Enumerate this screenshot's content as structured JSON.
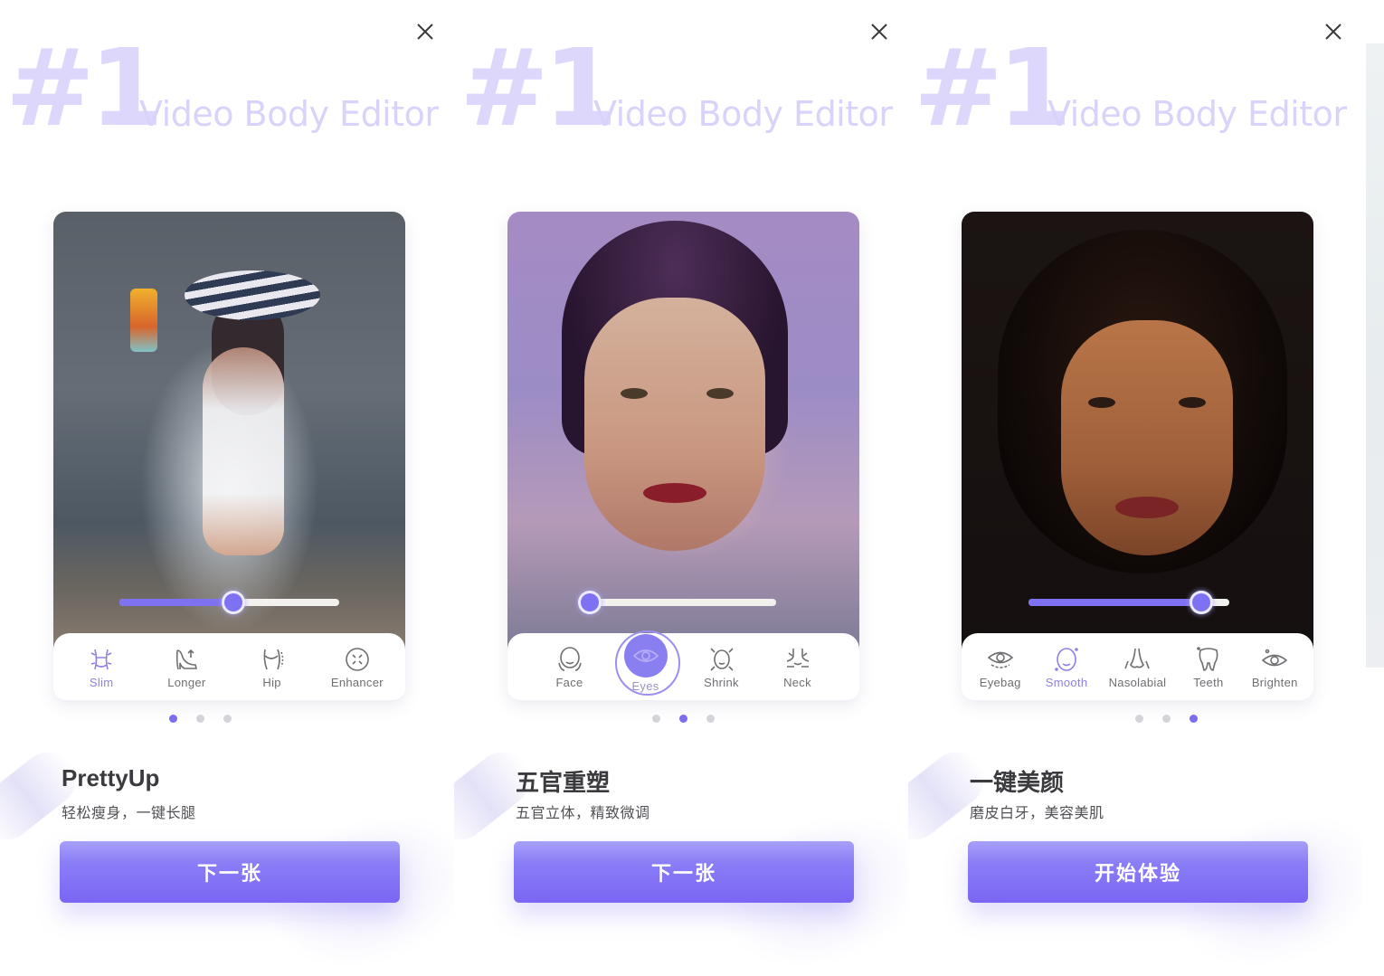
{
  "colors": {
    "accent": "#7b6cf0",
    "hero_text": "#dcd7fb",
    "button_top": "#a7a0f8",
    "button_bottom": "#7a66f4",
    "inactive_dot": "#d4d4d8"
  },
  "panels": [
    {
      "close_icon": "close-icon",
      "hero": {
        "rank": "#1",
        "tagline": "Video Body Editor"
      },
      "photo_description": "woman in striped sun hat and white swimsuit holding a drink on a beach",
      "slider": {
        "value_percent": 52
      },
      "tools": [
        {
          "label": "Slim",
          "icon": "waist-slim-icon",
          "active": true
        },
        {
          "label": "Longer",
          "icon": "high-heel-icon",
          "active": false
        },
        {
          "label": "Hip",
          "icon": "hip-icon",
          "active": false
        },
        {
          "label": "Enhancer",
          "icon": "expand-circle-icon",
          "active": false
        }
      ],
      "pagination": {
        "total": 3,
        "current": 1
      },
      "title": "PrettyUp",
      "subtitle": "轻松瘦身，一键长腿",
      "button_label": "下一张"
    },
    {
      "close_icon": "close-icon",
      "hero": {
        "rank": "#1",
        "tagline": "Video Body Editor"
      },
      "photo_description": "close-up portrait of woman with slicked dark hair on purple background",
      "slider": {
        "value_percent": 4
      },
      "tools": [
        {
          "label": "Face",
          "icon": "face-icon",
          "active": false
        },
        {
          "label": "Eyes",
          "icon": "eye-icon",
          "active": true
        },
        {
          "label": "Shrink",
          "icon": "face-shrink-icon",
          "active": false
        },
        {
          "label": "Neck",
          "icon": "neck-icon",
          "active": false
        }
      ],
      "pagination": {
        "total": 3,
        "current": 2
      },
      "title": "五官重塑",
      "subtitle": "五官立体，精致微调",
      "button_label": "下一张"
    },
    {
      "close_icon": "close-icon",
      "hero": {
        "rank": "#1",
        "tagline": "Video Body Editor"
      },
      "photo_description": "close-up portrait of woman with curly dark hair on black background",
      "slider": {
        "value_percent": 86
      },
      "tools": [
        {
          "label": "Eyebag",
          "icon": "eyebag-icon",
          "active": false
        },
        {
          "label": "Smooth",
          "icon": "smooth-face-icon",
          "active": true
        },
        {
          "label": "Nasolabial",
          "icon": "nose-icon",
          "active": false
        },
        {
          "label": "Teeth",
          "icon": "tooth-icon",
          "active": false
        },
        {
          "label": "Brighten",
          "icon": "brighten-eye-icon",
          "active": false
        }
      ],
      "pagination": {
        "total": 3,
        "current": 3
      },
      "title": "一键美颜",
      "subtitle": "磨皮白牙，美容美肌",
      "button_label": "开始体验"
    }
  ]
}
